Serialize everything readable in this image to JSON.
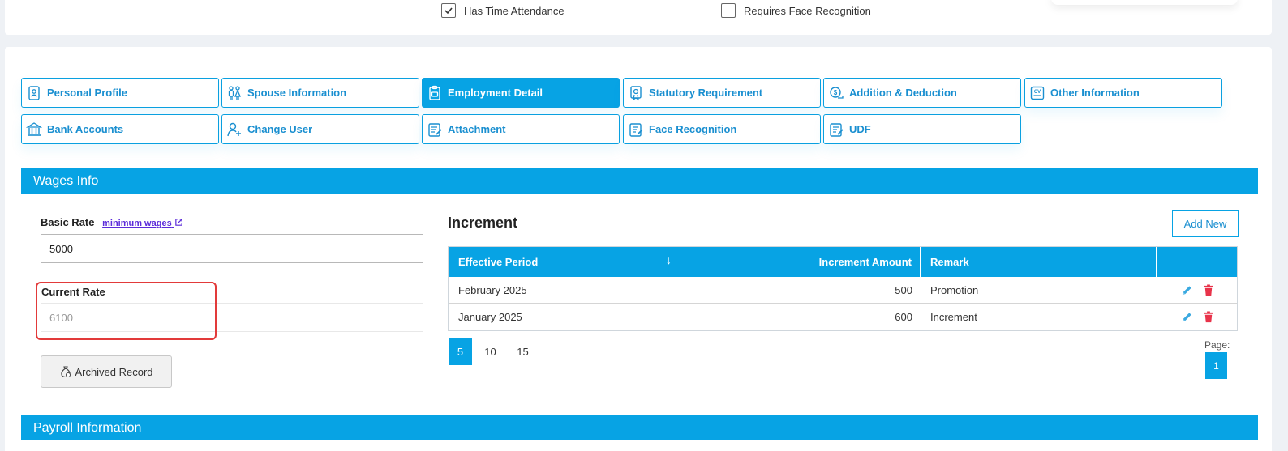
{
  "header": {
    "has_time_attendance_label": "Has Time Attendance",
    "has_time_attendance_checked": true,
    "requires_face_label": "Requires Face Recognition",
    "requires_face_checked": false
  },
  "tabs": [
    {
      "label": "Personal Profile",
      "icon": "profile-icon",
      "active": false
    },
    {
      "label": "Spouse Information",
      "icon": "couple-icon",
      "active": false
    },
    {
      "label": "Employment Detail",
      "icon": "clipboard-icon",
      "active": true
    },
    {
      "label": "Statutory Requirement",
      "icon": "certificate-icon",
      "active": false
    },
    {
      "label": "Addition & Deduction",
      "icon": "money-icon",
      "active": false
    },
    {
      "label": "Other Information",
      "icon": "cv-icon",
      "active": false
    },
    {
      "label": "Bank Accounts",
      "icon": "bank-icon",
      "active": false
    },
    {
      "label": "Change User",
      "icon": "user-add-icon",
      "active": false
    },
    {
      "label": "Attachment",
      "icon": "document-edit-icon",
      "active": false
    },
    {
      "label": "Face Recognition",
      "icon": "document-edit-icon",
      "active": false
    },
    {
      "label": "UDF",
      "icon": "document-edit-icon",
      "active": false
    }
  ],
  "wages": {
    "section_title": "Wages Info",
    "basic_rate_label": "Basic Rate",
    "minimum_wages_link": "minimum wages",
    "basic_rate_value": "5000",
    "current_rate_label": "Current Rate",
    "current_rate_value": "6100",
    "archived_button": "Archived Record"
  },
  "increment": {
    "title": "Increment",
    "add_new": "Add New",
    "columns": [
      "Effective Period",
      "Increment Amount",
      "Remark",
      ""
    ],
    "rows": [
      {
        "period": "February 2025",
        "amount": "500",
        "remark": "Promotion"
      },
      {
        "period": "January 2025",
        "amount": "600",
        "remark": "Increment"
      }
    ],
    "page_sizes": [
      "5",
      "10",
      "15"
    ],
    "page_size_selected": "5",
    "page_label": "Page:",
    "page_current": "1"
  },
  "payroll": {
    "section_title": "Payroll Information"
  },
  "colors": {
    "accent": "#07a3e4",
    "highlight": "#e23a3a",
    "delete": "#e8334a",
    "edit": "#3aa9e0"
  }
}
